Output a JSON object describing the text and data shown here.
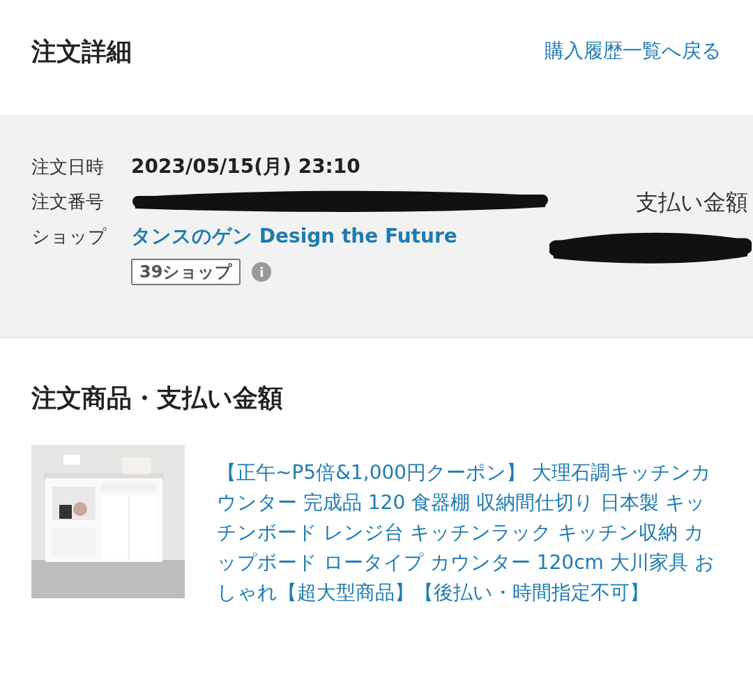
{
  "header": {
    "title": "注文詳細",
    "back_link": "購入履歴一覧へ戻る"
  },
  "order_info": {
    "rows": [
      {
        "kind": "text",
        "label": "注文日時",
        "value": "2023/05/15(月) 23:10"
      },
      {
        "kind": "redacted",
        "label": "注文番号"
      },
      {
        "kind": "link",
        "label": "ショップ",
        "value": "タンスのゲン Design the Future"
      }
    ],
    "badge": "39ショップ",
    "info_icon": "i",
    "payment_label": "支払い金額",
    "payment_redacted": true
  },
  "items_section": {
    "title": "注文商品・支払い金額",
    "items": [
      {
        "name": "【正午~P5倍&1,000円クーポン】 大理石調キッチンカウンター 完成品 120 食器棚 収納間仕切り 日本製 キッチンボード レンジ台 キッチンラック キッチン収納 カップボード ロータイプ カウンター 120cm 大川家具 おしゃれ【超大型商品】【後払い・時間指定不可】"
      }
    ]
  }
}
